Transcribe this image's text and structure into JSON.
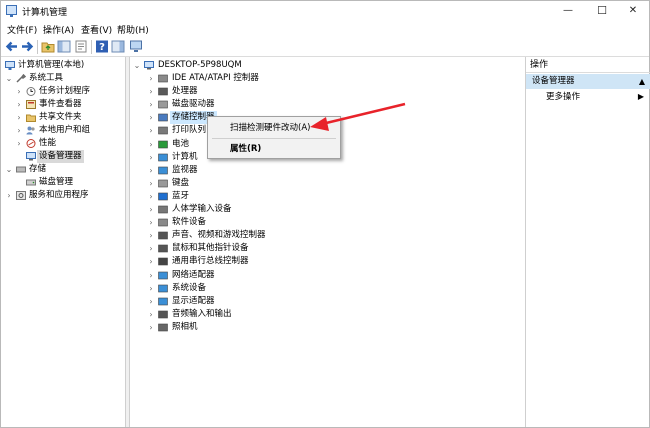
{
  "window": {
    "title": "计算机管理",
    "min": "—",
    "max": "☐",
    "close": "✕"
  },
  "menu": [
    "文件(F)",
    "操作(A)",
    "查看(V)",
    "帮助(H)"
  ],
  "left_tree": {
    "root": "计算机管理(本地)",
    "system_tools": "系统工具",
    "items": [
      "任务计划程序",
      "事件查看器",
      "共享文件夹",
      "本地用户和组",
      "性能",
      "设备管理器"
    ],
    "storage": "存储",
    "disk_mgmt": "磁盘管理",
    "services": "服务和应用程序"
  },
  "device_tree": {
    "root": "DESKTOP-5P98UQM",
    "items": [
      "IDE ATA/ATAPI 控制器",
      "处理器",
      "磁盘驱动器",
      "存储控制器",
      "打印队列",
      "电池",
      "计算机",
      "监视器",
      "键盘",
      "蓝牙",
      "人体学输入设备",
      "软件设备",
      "声音、视频和游戏控制器",
      "鼠标和其他指针设备",
      "通用串行总线控制器",
      "网络适配器",
      "系统设备",
      "显示适配器",
      "音频输入和输出",
      "照相机"
    ]
  },
  "context_menu": {
    "scan": "扫描检测硬件改动(A)",
    "props": "属性(R)"
  },
  "actions": {
    "header": "操作",
    "selected": "设备管理器",
    "more": "更多操作"
  },
  "colors": {
    "arrow": "#e8232a",
    "selection": "#cfe5f6",
    "accent": "#3b6fb6"
  }
}
